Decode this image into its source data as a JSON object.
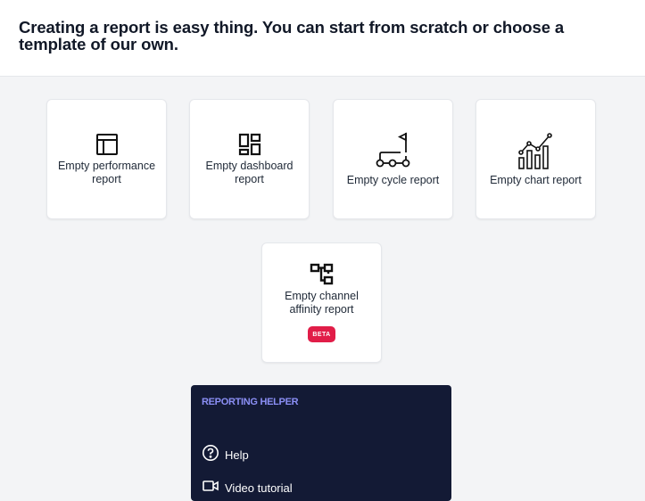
{
  "header": {
    "title": "Creating a report is easy thing. You can start from scratch or choose a template of our own."
  },
  "cards": [
    {
      "label": "Empty performance report",
      "icon": "table-layout-icon"
    },
    {
      "label": "Empty dashboard report",
      "icon": "dashboard-icon"
    },
    {
      "label": "Empty cycle report",
      "icon": "cycle-flag-icon"
    },
    {
      "label": "Empty chart report",
      "icon": "chart-icon"
    },
    {
      "label": "Empty channel affinity report",
      "icon": "hierarchy-icon",
      "badge": "BETA"
    }
  ],
  "helper": {
    "title": "REPORTING HELPER",
    "items": [
      {
        "label": "Help",
        "icon": "question-circle-icon"
      },
      {
        "label": "Video tutorial",
        "icon": "video-camera-icon"
      }
    ]
  },
  "colors": {
    "background": "#f3f4f6",
    "helper_bg": "#131a35",
    "helper_title": "#8b8ff5",
    "beta_badge": "#e11d48"
  }
}
